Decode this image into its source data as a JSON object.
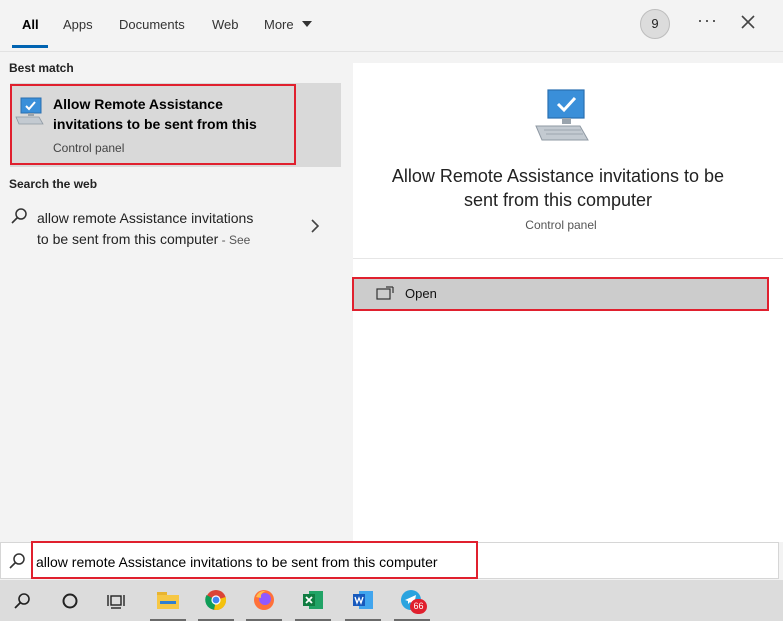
{
  "tabs": {
    "all": "All",
    "apps": "Apps",
    "documents": "Documents",
    "web": "Web",
    "more": "More"
  },
  "header": {
    "points": "9",
    "more_options": "···"
  },
  "best_match": {
    "section_label": "Best match",
    "title_line1": "Allow Remote Assistance",
    "title_line2": "invitations to be sent from this",
    "subtitle": "Control panel"
  },
  "web_search": {
    "section_label": "Search the web",
    "line1": "allow remote Assistance invitations",
    "line2": "to be sent from this computer",
    "see_suffix": " - See"
  },
  "preview": {
    "title_line1": "Allow Remote Assistance invitations to be",
    "title_line2": "sent from this computer",
    "subtitle": "Control panel",
    "open_label": "Open"
  },
  "search": {
    "query": "allow remote Assistance invitations to be sent from this computer"
  },
  "taskbar": {
    "items": [
      "search-icon",
      "cortana-icon",
      "task-view-icon",
      "file-explorer-icon",
      "chrome-icon",
      "firefox-icon",
      "excel-icon",
      "word-icon",
      "telegram-icon"
    ],
    "notification_badge": "66"
  },
  "colors": {
    "highlight_red": "#e0202e",
    "accent_blue": "#0063b1"
  }
}
